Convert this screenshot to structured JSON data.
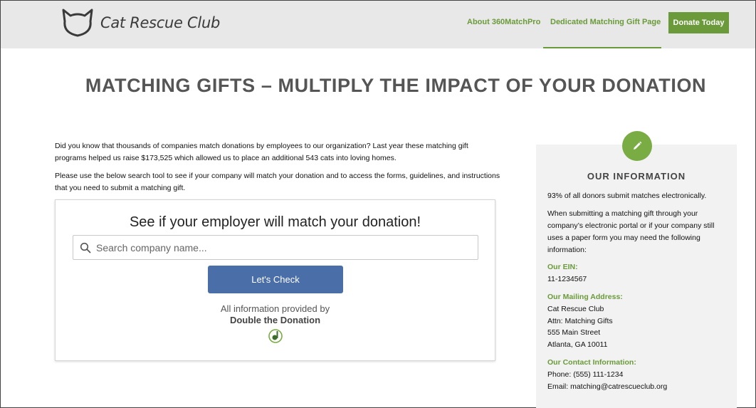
{
  "header": {
    "logo_text": "Cat Rescue Club",
    "nav": {
      "about": "About 360MatchPro",
      "dedicated": "Dedicated Matching Gift Page",
      "donate": "Donate Today"
    }
  },
  "page_title": "MATCHING GIFTS – MULTIPLY THE IMPACT OF YOUR DONATION",
  "intro": {
    "p1": "Did you know that thousands of companies match donations by employees to our organization? Last year these matching gift programs helped us raise $173,525 which allowed us to place an additional 543 cats into loving homes.",
    "p2": "Please use the below search tool to see if your company will match your donation and to access the forms, guidelines, and instructions that you need to submit a matching gift."
  },
  "search_widget": {
    "title": "See if your employer will match your donation!",
    "placeholder": "Search company name...",
    "button": "Let's Check",
    "provided_by": "All information provided by",
    "provider_name": "Double the Donation"
  },
  "sidebar": {
    "title": "OUR INFORMATION",
    "stat": "93% of all donors submit matches electronically.",
    "instructions": "When submitting a matching gift through your company’s electronic portal or if your company still uses a paper form you may need the following information:",
    "ein_label": "Our EIN:",
    "ein": "11-1234567",
    "address_label": "Our Mailing Address:",
    "address_lines": [
      "Cat Rescue Club",
      "Attn: Matching Gifts",
      "555 Main Street",
      "Atlanta, GA 10011"
    ],
    "contact_label": "Our Contact Information:",
    "phone": "Phone: (555) 111-1234",
    "email": "Email: matching@catrescueclub.org"
  },
  "colors": {
    "accent_green": "#6a9a3a",
    "button_blue": "#4a6ea8",
    "header_bg": "#e8e8e8"
  },
  "icons": [
    "cat-logo-icon",
    "search-icon",
    "pencil-icon",
    "double-the-donation-logo-icon"
  ]
}
